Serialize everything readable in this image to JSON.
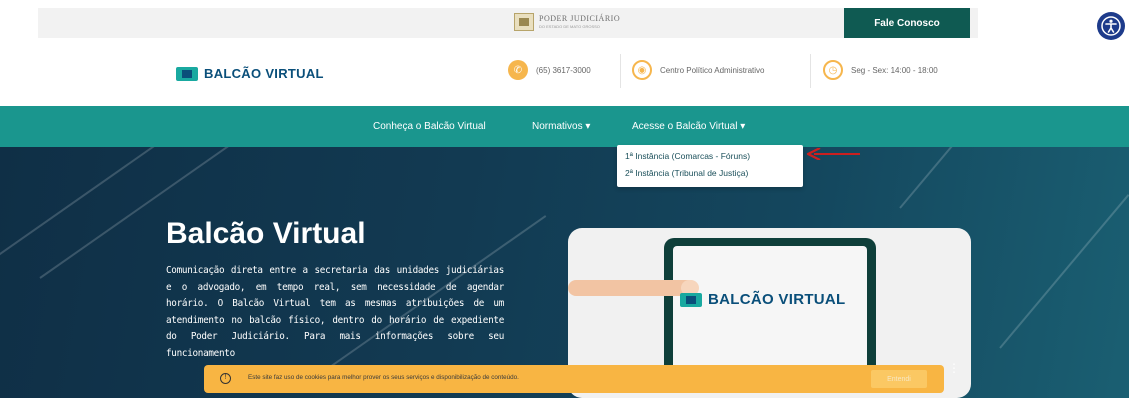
{
  "header": {
    "pj_title": "PODER JUDICIÁRIO",
    "pj_sub": "DO ESTADO DE MATO GROSSO",
    "fale_label": "Fale Conosco"
  },
  "brand": {
    "name": "BALCÃO VIRTUAL"
  },
  "contacts": {
    "phone": "(65) 3617-3000",
    "address": "Centro Político Administrativo",
    "hours": "Seg - Sex: 14:00 - 18:00"
  },
  "nav": {
    "items": [
      "Conheça o Balcão Virtual",
      "Normativos ▾",
      "Acesse o Balcão Virtual ▾"
    ]
  },
  "dropdown": {
    "items": [
      "1ª Instância (Comarcas - Fóruns)",
      "2ª Instância (Tribunal de Justiça)"
    ]
  },
  "hero": {
    "title": "Balcão Virtual",
    "description": "Comunicação direta entre a secretaria das unidades judiciárias e o advogado, em tempo real, sem necessidade de agendar horário. O Balcão Virtual tem as mesmas atribuições de um atendimento no balcão físico, dentro do horário de expediente do Poder Judiciário. Para mais informações sobre seu funcionamento"
  },
  "video": {
    "brand": "BALCÃO VIRTUAL"
  },
  "cookie": {
    "text": "Este site faz uso de cookies para melhor prover os seus serviços e disponibilização de conteúdo.",
    "button": "Entendi"
  },
  "colors": {
    "teal": "#1a968e",
    "dark_green": "#0f5a52",
    "navy_brand": "#0a4f7a",
    "accent_orange": "#f6b64d",
    "cookie_bg": "#f8b543",
    "arrow_red": "#cc1f1f"
  }
}
